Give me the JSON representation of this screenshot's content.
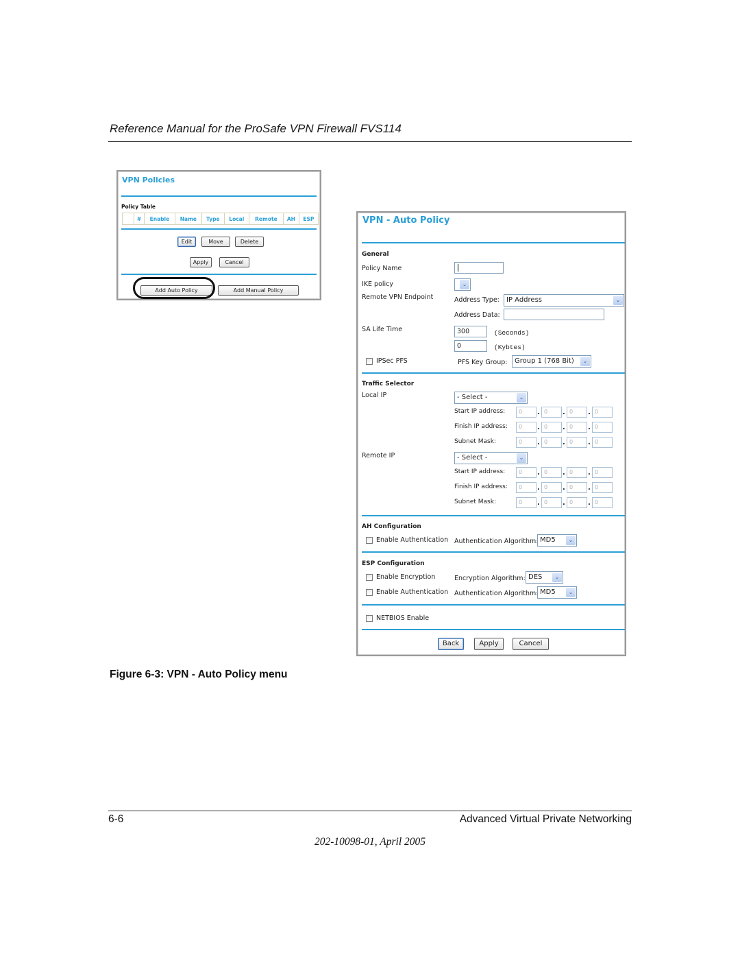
{
  "document": {
    "header_title": "Reference Manual for the ProSafe VPN Firewall FVS114",
    "figure_caption": "Figure 6-3: VPN - Auto Policy menu",
    "footer_page": "6-6",
    "footer_section": "Advanced Virtual Private Networking",
    "footer_doc_id": "202-10098-01, April 2005"
  },
  "colors": {
    "accent": "#2a9fd6",
    "table_border": "#d8d2b8",
    "input_border": "#7f9db9"
  },
  "vpn_policies": {
    "title": "VPN Policies",
    "table_label": "Policy Table",
    "columns": [
      "",
      "#",
      "Enable",
      "Name",
      "Type",
      "Local",
      "Remote",
      "AH",
      "ESP"
    ],
    "buttons": {
      "edit": "Edit",
      "move": "Move",
      "delete": "Delete",
      "apply": "Apply",
      "cancel": "Cancel",
      "add_auto": "Add Auto Policy",
      "add_manual": "Add Manual Policy"
    }
  },
  "auto_policy": {
    "title": "VPN - Auto Policy",
    "general": {
      "heading": "General",
      "policy_name_label": "Policy Name",
      "policy_name_value": "",
      "ike_policy_label": "IKE policy",
      "ike_policy_value": "",
      "remote_endpoint_label": "Remote VPN Endpoint",
      "address_type_label": "Address Type:",
      "address_type_value": "IP Address",
      "address_data_label": "Address Data:",
      "address_data_value": "",
      "sa_lifetime_label": "SA Life Time",
      "sa_seconds_value": "300",
      "sa_seconds_unit": "(Seconds)",
      "sa_kbytes_value": "0",
      "sa_kbytes_unit": "(Kybtes)",
      "ipsec_pfs_label": "IPSec PFS",
      "ipsec_pfs_checked": false,
      "pfs_key_group_label": "PFS Key Group:",
      "pfs_key_group_value": "Group 1 (768 Bit)"
    },
    "traffic_selector": {
      "heading": "Traffic Selector",
      "local": {
        "label": "Local IP",
        "select_value": "- Select -",
        "start_label": "Start IP address:",
        "start": [
          "0",
          "0",
          "0",
          "0"
        ],
        "finish_label": "Finish IP address:",
        "finish": [
          "0",
          "0",
          "0",
          "0"
        ],
        "mask_label": "Subnet Mask:",
        "mask": [
          "0",
          "0",
          "0",
          "0"
        ]
      },
      "remote": {
        "label": "Remote IP",
        "select_value": "- Select -",
        "start_label": "Start IP address:",
        "start": [
          "0",
          "0",
          "0",
          "0"
        ],
        "finish_label": "Finish IP address:",
        "finish": [
          "0",
          "0",
          "0",
          "0"
        ],
        "mask_label": "Subnet Mask:",
        "mask": [
          "0",
          "0",
          "0",
          "0"
        ]
      }
    },
    "ah": {
      "heading": "AH Configuration",
      "enable_auth_label": "Enable Authentication",
      "enable_auth_checked": false,
      "auth_algo_label": "Authentication Algorithm:",
      "auth_algo_value": "MD5"
    },
    "esp": {
      "heading": "ESP Configuration",
      "enable_enc_label": "Enable Encryption",
      "enable_enc_checked": false,
      "enc_algo_label": "Encryption Algorithm:",
      "enc_algo_value": "DES",
      "enable_auth_label": "Enable Authentication",
      "enable_auth_checked": false,
      "auth_algo_label": "Authentication Algorithm:",
      "auth_algo_value": "MD5"
    },
    "netbios_label": "NETBIOS Enable",
    "netbios_checked": false,
    "buttons": {
      "back": "Back",
      "apply": "Apply",
      "cancel": "Cancel"
    }
  }
}
